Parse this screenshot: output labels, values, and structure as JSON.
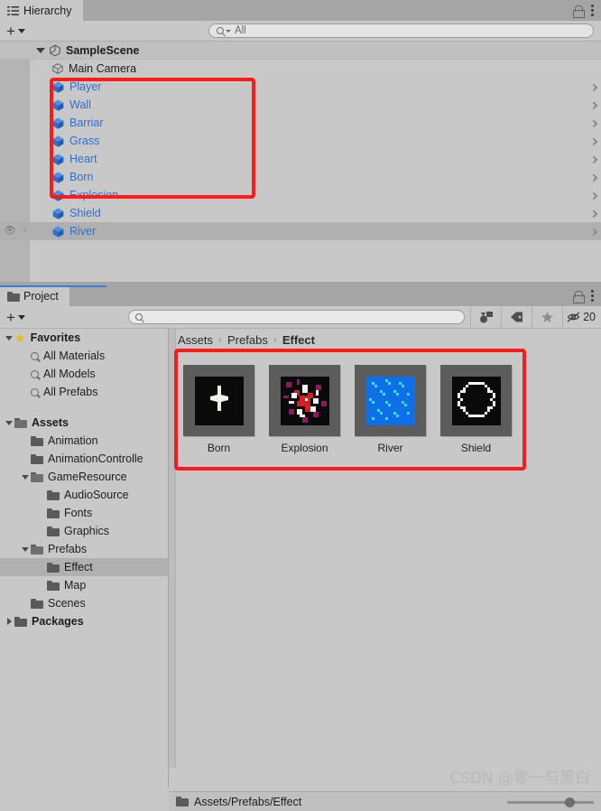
{
  "hierarchy": {
    "tab_label": "Hierarchy",
    "tab_icon": "hierarchy-icon",
    "lock_icon": "lock-icon",
    "menu_icon": "kebab-menu-icon",
    "add_label": "+",
    "search_placeholder": "All",
    "search_value": "",
    "scene": {
      "name": "SampleScene",
      "icon": "unity-scene-icon",
      "expanded": true
    },
    "items": [
      {
        "label": "Main Camera",
        "icon": "cube-outline-icon",
        "is_prefab": false,
        "hovered": false
      },
      {
        "label": "Player",
        "icon": "prefab-cube-icon",
        "is_prefab": true,
        "hovered": false
      },
      {
        "label": "Wall",
        "icon": "prefab-cube-icon",
        "is_prefab": true,
        "hovered": false
      },
      {
        "label": "Barriar",
        "icon": "prefab-cube-icon",
        "is_prefab": true,
        "hovered": false
      },
      {
        "label": "Grass",
        "icon": "prefab-cube-icon",
        "is_prefab": true,
        "hovered": false
      },
      {
        "label": "Heart",
        "icon": "prefab-cube-icon",
        "is_prefab": true,
        "hovered": false
      },
      {
        "label": "Born",
        "icon": "prefab-cube-icon",
        "is_prefab": true,
        "hovered": false
      },
      {
        "label": "Explosion",
        "icon": "prefab-cube-icon",
        "is_prefab": true,
        "hovered": false
      },
      {
        "label": "Shield",
        "icon": "prefab-cube-icon",
        "is_prefab": true,
        "hovered": false
      },
      {
        "label": "River",
        "icon": "prefab-cube-icon",
        "is_prefab": true,
        "hovered": true
      }
    ],
    "gutter_eye_icon": "eye-icon",
    "gutter_hand_icon": "hand-icon"
  },
  "project": {
    "tab_label": "Project",
    "tab_icon": "folder-icon",
    "lock_icon": "lock-icon",
    "menu_icon": "kebab-menu-icon",
    "add_label": "+",
    "search_placeholder": "",
    "search_value": "",
    "toolbar_icons": [
      {
        "name": "type-filter-icon",
        "glyph": "◓"
      },
      {
        "name": "label-filter-icon",
        "glyph": "⬗"
      },
      {
        "name": "favorite-star-icon",
        "glyph": "★"
      }
    ],
    "hidden_packages": {
      "icon": "eye-crossed-icon",
      "count": "20"
    },
    "tree": [
      {
        "label": "Favorites",
        "icon": "star-icon",
        "indent": 0,
        "twisty": "down",
        "bold": true,
        "selected": false
      },
      {
        "label": "All Materials",
        "icon": "search-icon",
        "indent": 1,
        "twisty": "none",
        "bold": false,
        "selected": false
      },
      {
        "label": "All Models",
        "icon": "search-icon",
        "indent": 1,
        "twisty": "none",
        "bold": false,
        "selected": false
      },
      {
        "label": "All Prefabs",
        "icon": "search-icon",
        "indent": 1,
        "twisty": "none",
        "bold": false,
        "selected": false
      },
      {
        "label": "",
        "icon": "spacer",
        "indent": 0,
        "twisty": "none",
        "bold": false,
        "selected": false
      },
      {
        "label": "Assets",
        "icon": "folder-open-icon",
        "indent": 0,
        "twisty": "down",
        "bold": true,
        "selected": false
      },
      {
        "label": "Animation",
        "icon": "folder-icon",
        "indent": 1,
        "twisty": "none",
        "bold": false,
        "selected": false
      },
      {
        "label": "AnimationControlle",
        "icon": "folder-icon",
        "indent": 1,
        "twisty": "none",
        "bold": false,
        "selected": false
      },
      {
        "label": "GameResource",
        "icon": "folder-open-icon",
        "indent": 1,
        "twisty": "down",
        "bold": false,
        "selected": false
      },
      {
        "label": "AudioSource",
        "icon": "folder-icon",
        "indent": 2,
        "twisty": "none",
        "bold": false,
        "selected": false
      },
      {
        "label": "Fonts",
        "icon": "folder-icon",
        "indent": 2,
        "twisty": "none",
        "bold": false,
        "selected": false
      },
      {
        "label": "Graphics",
        "icon": "folder-icon",
        "indent": 2,
        "twisty": "none",
        "bold": false,
        "selected": false
      },
      {
        "label": "Prefabs",
        "icon": "folder-open-icon",
        "indent": 1,
        "twisty": "down",
        "bold": false,
        "selected": false
      },
      {
        "label": "Effect",
        "icon": "folder-icon",
        "indent": 2,
        "twisty": "none",
        "bold": false,
        "selected": true
      },
      {
        "label": "Map",
        "icon": "folder-icon",
        "indent": 2,
        "twisty": "none",
        "bold": false,
        "selected": false
      },
      {
        "label": "Scenes",
        "icon": "folder-icon",
        "indent": 1,
        "twisty": "none",
        "bold": false,
        "selected": false
      },
      {
        "label": "Packages",
        "icon": "folder-icon",
        "indent": 0,
        "twisty": "right",
        "bold": true,
        "selected": false
      }
    ],
    "breadcrumb": [
      "Assets",
      "Prefabs",
      "Effect"
    ],
    "breadcrumb_separator": "›",
    "assets": [
      {
        "name": "Born",
        "thumb": "born-star-thumb"
      },
      {
        "name": "Explosion",
        "thumb": "explosion-thumb"
      },
      {
        "name": "River",
        "thumb": "river-water-thumb"
      },
      {
        "name": "Shield",
        "thumb": "shield-outline-thumb"
      }
    ],
    "status_path": "Assets/Prefabs/Effect",
    "status_icon": "folder-icon",
    "zoom_slider": {
      "name": "thumbnail-size-slider",
      "value": "67"
    }
  },
  "watermark": {
    "text": "CSDN @零一与黑白"
  },
  "colors": {
    "annotation": "#fc1b1b",
    "prefab_blue": "#2f6fd0",
    "panel_bg": "#c8c8c8",
    "tabbar_bg": "#a5a5a5",
    "accent": "#3b7fd4"
  }
}
